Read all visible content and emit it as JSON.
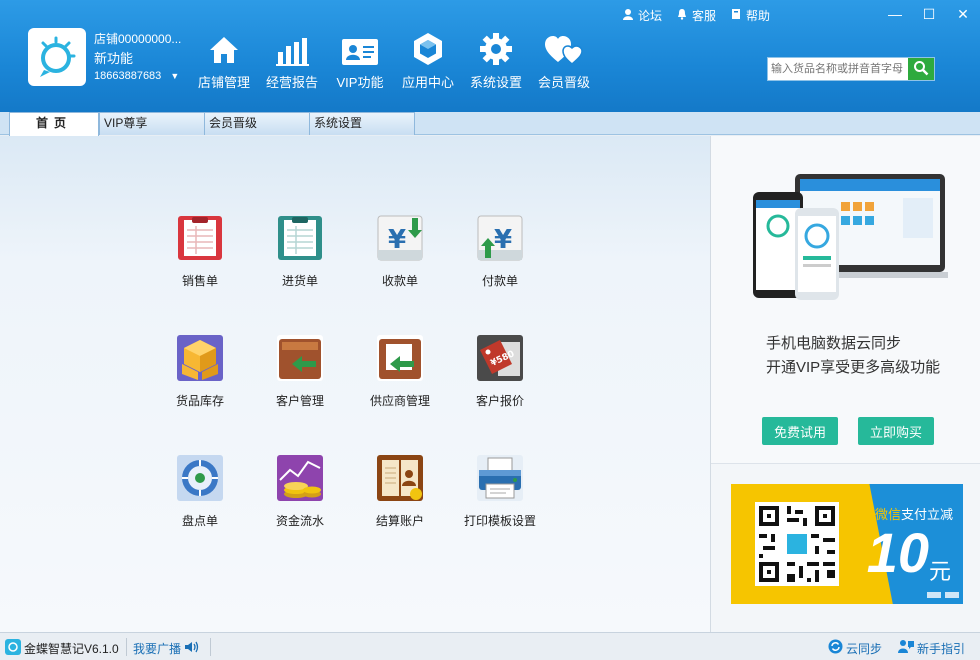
{
  "header": {
    "shop_name": "店铺00000000...",
    "new_feature": "新功能",
    "phone": "18663887683",
    "top_links": [
      {
        "label": "论坛",
        "icon": "person-icon"
      },
      {
        "label": "客服",
        "icon": "bell-icon"
      },
      {
        "label": "帮助",
        "icon": "book-icon"
      }
    ],
    "window_controls": {
      "minimize": "—",
      "maximize": "☐",
      "close": "✕"
    },
    "nav": [
      {
        "label": "店铺管理",
        "icon": "house-icon"
      },
      {
        "label": "经营报告",
        "icon": "bar-chart-icon"
      },
      {
        "label": "VIP功能",
        "icon": "vip-card-icon"
      },
      {
        "label": "应用中心",
        "icon": "hexagon-app-icon"
      },
      {
        "label": "系统设置",
        "icon": "gear-icon"
      },
      {
        "label": "会员晋级",
        "icon": "hearts-icon"
      }
    ],
    "search_placeholder": "输入货品名称或拼音首字母"
  },
  "tabs": [
    {
      "label": "首页",
      "active": true
    },
    {
      "label": "VIP尊享",
      "active": false
    },
    {
      "label": "会员晋级",
      "active": false
    },
    {
      "label": "系统设置",
      "active": false
    }
  ],
  "tiles": [
    {
      "label": "销售单",
      "icon": "sales-order-icon",
      "color": "#d9363e"
    },
    {
      "label": "进货单",
      "icon": "purchase-order-icon",
      "color": "#2f8f8a"
    },
    {
      "label": "收款单",
      "icon": "receipt-icon",
      "color": "#2e9a4a"
    },
    {
      "label": "付款单",
      "icon": "payment-icon",
      "color": "#2e9a4a"
    },
    {
      "label": "货品库存",
      "icon": "inventory-boxes-icon",
      "color": "#f2a51a"
    },
    {
      "label": "客户管理",
      "icon": "customer-folder-icon",
      "color": "#a0522d"
    },
    {
      "label": "供应商管理",
      "icon": "supplier-folder-icon",
      "color": "#a0522d"
    },
    {
      "label": "客户报价",
      "icon": "price-tag-icon",
      "color": "#c0392b"
    },
    {
      "label": "盘点单",
      "icon": "stocktake-icon",
      "color": "#3b78c6"
    },
    {
      "label": "资金流水",
      "icon": "coins-chart-icon",
      "color": "#8e44ad"
    },
    {
      "label": "结算账户",
      "icon": "account-book-icon",
      "color": "#8b4513"
    },
    {
      "label": "打印模板设置",
      "icon": "printer-icon",
      "color": "#2a6fb0"
    }
  ],
  "side": {
    "promo_line1": "手机电脑数据云同步",
    "promo_line2": "开通VIP享受更多高级功能",
    "trial_button": "免费试用",
    "buy_button": "立即购买",
    "banner_wechat": "微信",
    "banner_pay": "支付立减",
    "banner_amount": "10",
    "banner_unit": "元"
  },
  "status": {
    "version": "金蝶智慧记V6.1.0",
    "broadcast": "我要广播",
    "sync": "云同步",
    "guide": "新手指引"
  }
}
